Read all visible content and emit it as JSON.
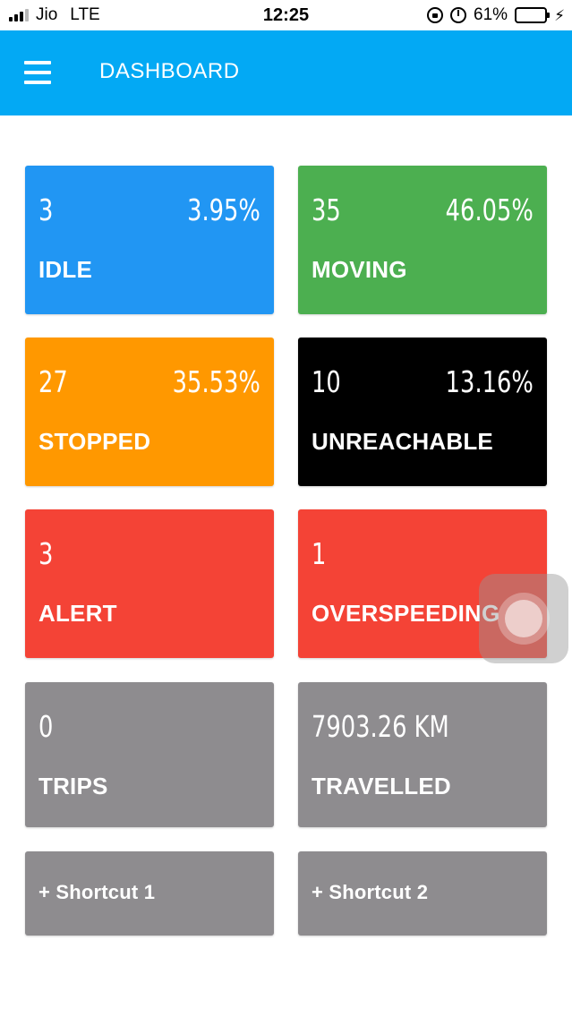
{
  "status_bar": {
    "carrier": "Jio",
    "network": "LTE",
    "time": "12:25",
    "battery_percent": "61%",
    "battery_level": 0.61,
    "icons": [
      "signal-icon",
      "orientation-lock-icon",
      "alarm-icon",
      "battery-icon",
      "charging-bolt-icon"
    ]
  },
  "app_bar": {
    "title": "DASHBOARD",
    "color": "#03a9f4",
    "menu_icon": "hamburger-menu-icon"
  },
  "cards": [
    {
      "id": "idle",
      "count": "3",
      "percent": "3.95%",
      "label": "IDLE",
      "color": "#2196f3"
    },
    {
      "id": "moving",
      "count": "35",
      "percent": "46.05%",
      "label": "MOVING",
      "color": "#4caf50"
    },
    {
      "id": "stopped",
      "count": "27",
      "percent": "35.53%",
      "label": "STOPPED",
      "color": "#ff9800"
    },
    {
      "id": "unreachable",
      "count": "10",
      "percent": "13.16%",
      "label": "UNREACHABLE",
      "color": "#000000"
    },
    {
      "id": "alert",
      "count": "3",
      "label": "ALERT",
      "color": "#f44336"
    },
    {
      "id": "overspeeding",
      "count": "1",
      "label": "OVERSPEEDING",
      "color": "#f44336"
    },
    {
      "id": "trips",
      "count": "0",
      "label": "TRIPS",
      "color": "#8e8c8f"
    },
    {
      "id": "travelled",
      "count": "7903.26 KM",
      "label": "TRAVELLED",
      "color": "#8e8c8f"
    }
  ],
  "shortcuts": [
    {
      "label": "+ Shortcut 1",
      "color": "#8e8c8f"
    },
    {
      "label": "+ Shortcut 2",
      "color": "#8e8c8f"
    }
  ]
}
